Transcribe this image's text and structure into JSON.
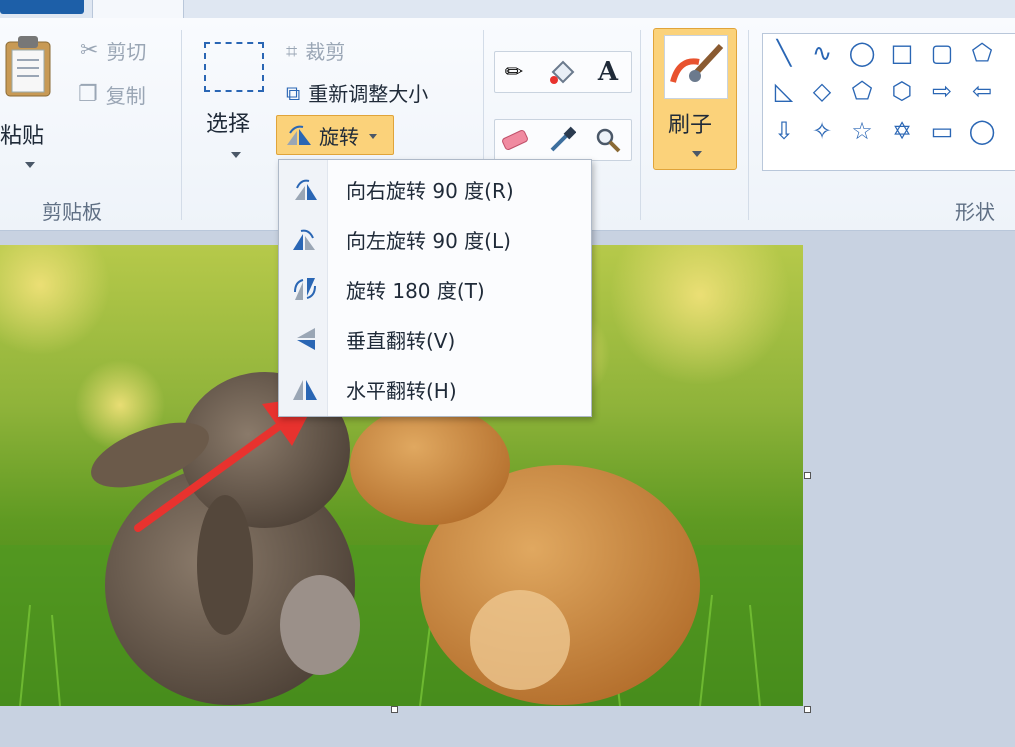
{
  "ribbon": {
    "clipboard": {
      "paste_label": "粘贴",
      "cut_label": "剪切",
      "copy_label": "复制",
      "group_label": "剪贴板"
    },
    "image": {
      "select_label": "选择",
      "crop_label": "裁剪",
      "resize_label": "重新调整大小",
      "rotate_label": "旋转"
    },
    "tools": [
      "pencil-icon",
      "fill-icon",
      "text-icon",
      "eraser-icon",
      "color-picker-icon",
      "magnifier-icon"
    ],
    "tools_text_glyph": "A",
    "brushes_label": "刷子",
    "shapes_group_label": "形状"
  },
  "rotate_menu": {
    "items": [
      {
        "label": "向右旋转 90 度(R)",
        "icon": "rotate-right-icon"
      },
      {
        "label": "向左旋转 90 度(L)",
        "icon": "rotate-left-icon"
      },
      {
        "label": "旋转 180 度(T)",
        "icon": "rotate-180-icon"
      },
      {
        "label": "垂直翻转(V)",
        "icon": "flip-vertical-icon"
      },
      {
        "label": "水平翻转(H)",
        "icon": "flip-horizontal-icon"
      }
    ]
  },
  "colors": {
    "accent_highlight": "#fbd27a",
    "annotation_arrow": "#e8322e"
  }
}
